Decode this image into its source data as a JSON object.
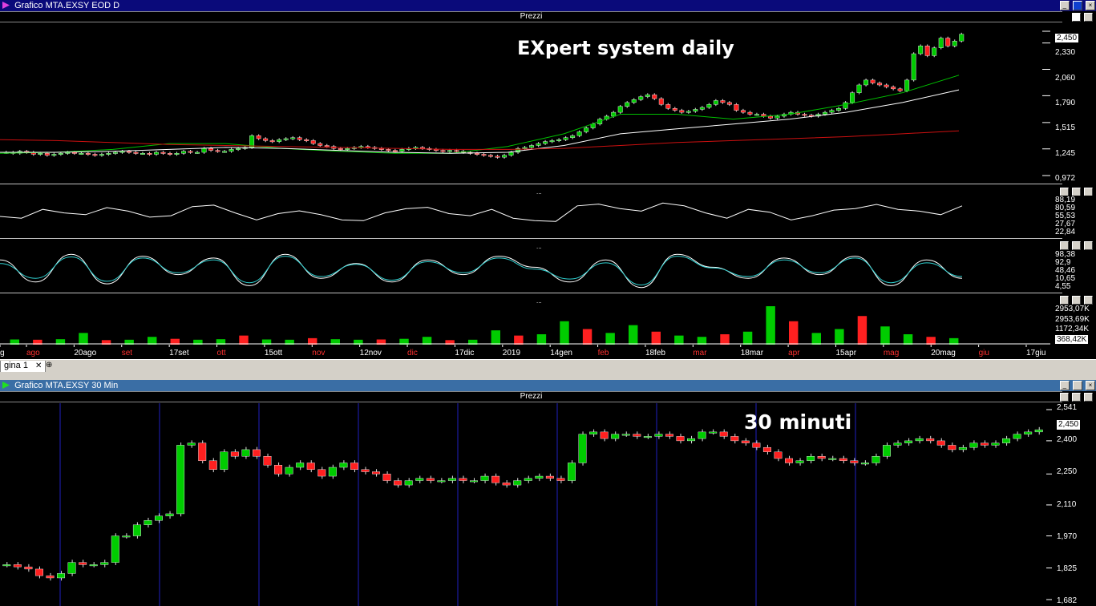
{
  "window1": {
    "title": "Grafico MTA.EXSY EOD D",
    "pane_title": "Prezzi",
    "overlay_title": "EXpert system daily",
    "price_axis": [
      "2,450",
      "2,330",
      "2,060",
      "1,790",
      "1,515",
      "1,245",
      "0,972"
    ],
    "rsi_axis": [
      "88,19",
      "80,59",
      "55,53",
      "27,67",
      "22,84"
    ],
    "stoch_axis": [
      "98,38",
      "92,9",
      "48,46",
      "10,65",
      "4,55"
    ],
    "volume_axis": [
      "2953,07K",
      "2953,69K",
      "1172,34K",
      "368,42K"
    ],
    "date_labels": [
      "g",
      "ago",
      "20ago",
      "set",
      "17set",
      "ott",
      "15ott",
      "nov",
      "12nov",
      "dic",
      "17dic",
      "2019",
      "14gen",
      "feb",
      "18feb",
      "mar",
      "18mar",
      "apr",
      "15apr",
      "mag",
      "20mag",
      "giu",
      "17giu"
    ]
  },
  "tabs": {
    "active_tab": "gina 1",
    "close_glyph": "✕",
    "new_tab_glyph": "⊕"
  },
  "window2": {
    "title": "Grafico MTA.EXSY 30 Min",
    "pane_title": "Prezzi",
    "overlay_title": "30 minuti",
    "price_tag": "2,450",
    "price_axis": [
      "2,541",
      "2,400",
      "2,250",
      "2,110",
      "1,970",
      "1,825",
      "1,682"
    ]
  },
  "buttons": {
    "minimize": "_",
    "restore": "□",
    "close": "×"
  },
  "colors": {
    "bull": "#00cc00",
    "bear": "#ff2020",
    "ma_short": "#00c000",
    "ma_mid": "#ffffff",
    "ma_long": "#cc1010",
    "stoch_k": "#ffffff",
    "stoch_d": "#2fd0d0",
    "session_line": "#2020c0",
    "titlebar": "#0a0a7a"
  },
  "chart_data": [
    {
      "type": "candlestick",
      "title": "EXpert system daily",
      "ylim": [
        0.972,
        2.45
      ],
      "y_ticks": [
        2.45,
        2.33,
        2.06,
        1.79,
        1.515,
        1.245,
        0.972
      ],
      "x_labels": [
        "ago",
        "20ago",
        "set",
        "17set",
        "ott",
        "15ott",
        "nov",
        "12nov",
        "dic",
        "17dic",
        "2019",
        "14gen",
        "feb",
        "18feb",
        "mar",
        "18mar",
        "apr",
        "15apr",
        "mag",
        "20mag",
        "giu",
        "17giu"
      ],
      "close": [
        1.21,
        1.2,
        1.22,
        1.21,
        1.19,
        1.2,
        1.18,
        1.19,
        1.2,
        1.21,
        1.2,
        1.2,
        1.19,
        1.18,
        1.19,
        1.2,
        1.21,
        1.22,
        1.21,
        1.2,
        1.2,
        1.19,
        1.21,
        1.2,
        1.19,
        1.2,
        1.22,
        1.21,
        1.21,
        1.25,
        1.23,
        1.22,
        1.22,
        1.24,
        1.25,
        1.26,
        1.38,
        1.35,
        1.33,
        1.32,
        1.34,
        1.35,
        1.36,
        1.34,
        1.33,
        1.3,
        1.28,
        1.27,
        1.25,
        1.24,
        1.25,
        1.26,
        1.27,
        1.26,
        1.25,
        1.24,
        1.23,
        1.22,
        1.24,
        1.25,
        1.26,
        1.25,
        1.24,
        1.23,
        1.22,
        1.23,
        1.22,
        1.21,
        1.2,
        1.19,
        1.18,
        1.17,
        1.16,
        1.18,
        1.21,
        1.25,
        1.26,
        1.28,
        1.3,
        1.32,
        1.33,
        1.34,
        1.36,
        1.38,
        1.42,
        1.46,
        1.5,
        1.55,
        1.58,
        1.62,
        1.68,
        1.72,
        1.75,
        1.78,
        1.8,
        1.76,
        1.7,
        1.66,
        1.64,
        1.62,
        1.63,
        1.65,
        1.67,
        1.7,
        1.74,
        1.72,
        1.7,
        1.64,
        1.62,
        1.6,
        1.6,
        1.58,
        1.56,
        1.58,
        1.6,
        1.62,
        1.6,
        1.59,
        1.58,
        1.6,
        1.62,
        1.64,
        1.66,
        1.72,
        1.82,
        1.9,
        1.95,
        1.92,
        1.9,
        1.88,
        1.86,
        1.84,
        1.95,
        2.22,
        2.3,
        2.2,
        2.28,
        2.38,
        2.3,
        2.35,
        2.42
      ],
      "series": [
        {
          "name": "MA breve",
          "values": [
            1.2,
            1.21,
            1.24,
            1.3,
            1.3,
            1.25,
            1.22,
            1.2,
            1.2,
            1.27,
            1.4,
            1.6,
            1.6,
            1.55,
            1.6,
            1.7,
            1.82,
            2.0
          ]
        },
        {
          "name": "MA media",
          "values": [
            1.21,
            1.21,
            1.22,
            1.24,
            1.26,
            1.25,
            1.23,
            1.21,
            1.2,
            1.21,
            1.28,
            1.4,
            1.45,
            1.5,
            1.55,
            1.62,
            1.72,
            1.85
          ]
        },
        {
          "name": "MA lunga",
          "values": [
            1.34,
            1.33,
            1.31,
            1.29,
            1.28,
            1.27,
            1.26,
            1.25,
            1.24,
            1.24,
            1.25,
            1.28,
            1.31,
            1.33,
            1.35,
            1.37,
            1.4,
            1.43
          ]
        }
      ]
    },
    {
      "type": "line",
      "ylim": [
        22.84,
        88.19
      ],
      "values": [
        50,
        45,
        70,
        60,
        55,
        75,
        65,
        48,
        52,
        78,
        82,
        60,
        40,
        58,
        66,
        55,
        40,
        38,
        60,
        72,
        76,
        58,
        52,
        70,
        45,
        38,
        36,
        80,
        85,
        72,
        65,
        88,
        80,
        60,
        45,
        70,
        62,
        40,
        52,
        68,
        72,
        84,
        70,
        65,
        55,
        80
      ]
    },
    {
      "type": "line",
      "ylim": [
        4.55,
        98.38
      ],
      "series": [
        {
          "name": "%K",
          "values": [
            80,
            20,
            95,
            15,
            90,
            40,
            85,
            10,
            95,
            30,
            70,
            20,
            80,
            40,
            90,
            60,
            20,
            80,
            5,
            95,
            60,
            30,
            85,
            40,
            90,
            10,
            80,
            30
          ]
        },
        {
          "name": "%D",
          "values": [
            70,
            30,
            88,
            22,
            85,
            45,
            80,
            18,
            90,
            35,
            68,
            25,
            75,
            45,
            85,
            55,
            28,
            72,
            12,
            90,
            58,
            35,
            80,
            45,
            85,
            18,
            72,
            35
          ]
        }
      ]
    },
    {
      "type": "bar",
      "ylim": [
        0,
        2953.69
      ],
      "values": [
        400,
        380,
        420,
        900,
        350,
        380,
        600,
        450,
        380,
        420,
        700,
        400,
        380,
        500,
        420,
        380,
        400,
        450,
        600,
        350,
        380,
        1100,
        700,
        800,
        1800,
        1200,
        900,
        1500,
        1000,
        700,
        600,
        800,
        1000,
        2953,
        1800,
        900,
        1200,
        2200,
        1400,
        800,
        600,
        500
      ]
    },
    {
      "type": "candlestick",
      "title": "30 minuti",
      "ylim": [
        1.682,
        2.541
      ],
      "y_ticks": [
        2.541,
        2.4,
        2.25,
        2.11,
        1.97,
        1.825,
        1.682
      ],
      "close": [
        1.84,
        1.83,
        1.82,
        1.79,
        1.78,
        1.8,
        1.85,
        1.84,
        1.84,
        1.85,
        1.97,
        1.97,
        2.02,
        2.04,
        2.06,
        2.07,
        2.38,
        2.39,
        2.31,
        2.27,
        2.35,
        2.33,
        2.36,
        2.33,
        2.29,
        2.25,
        2.28,
        2.3,
        2.27,
        2.24,
        2.28,
        2.3,
        2.27,
        2.26,
        2.25,
        2.22,
        2.2,
        2.22,
        2.23,
        2.22,
        2.22,
        2.23,
        2.22,
        2.22,
        2.24,
        2.21,
        2.2,
        2.22,
        2.23,
        2.24,
        2.23,
        2.22,
        2.3,
        2.43,
        2.44,
        2.41,
        2.43,
        2.43,
        2.42,
        2.42,
        2.43,
        2.42,
        2.4,
        2.41,
        2.44,
        2.44,
        2.42,
        2.4,
        2.39,
        2.37,
        2.35,
        2.32,
        2.3,
        2.31,
        2.33,
        2.32,
        2.32,
        2.31,
        2.3,
        2.3,
        2.33,
        2.38,
        2.39,
        2.4,
        2.41,
        2.4,
        2.38,
        2.36,
        2.37,
        2.39,
        2.38,
        2.39,
        2.41,
        2.43,
        2.44,
        2.45
      ],
      "session_separators": 9
    }
  ]
}
